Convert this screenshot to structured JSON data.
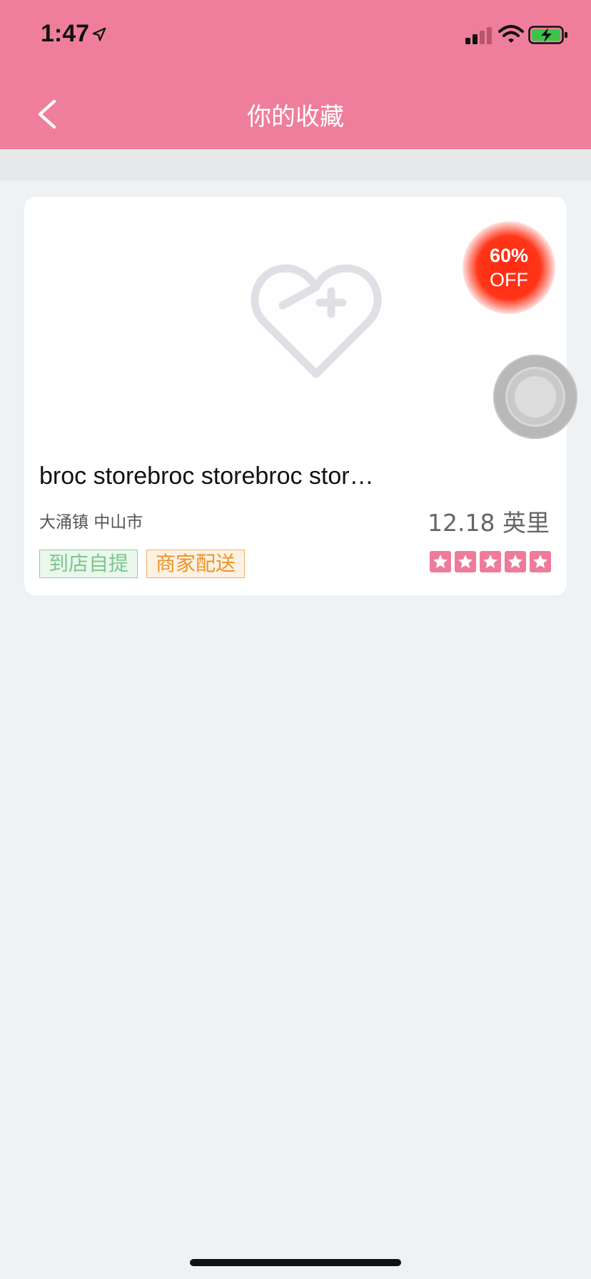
{
  "status_bar": {
    "time": "1:47"
  },
  "nav": {
    "title": "你的收藏"
  },
  "store": {
    "name": "broc storebroc storebroc stor…",
    "location": "大涌镇 中山市",
    "distance": "12.18 英里",
    "discount": {
      "percent": "60%",
      "label": "OFF"
    },
    "tags": [
      {
        "label": "到店自提"
      },
      {
        "label": "商家配送"
      }
    ],
    "rating": 5,
    "rating_max": 5
  },
  "colors": {
    "header": "#ef7e9a",
    "accent_star": "#ee7b9a",
    "badge": "#ff2a12",
    "pickup_tag": "#7ec58e",
    "delivery_tag": "#e8952e"
  }
}
